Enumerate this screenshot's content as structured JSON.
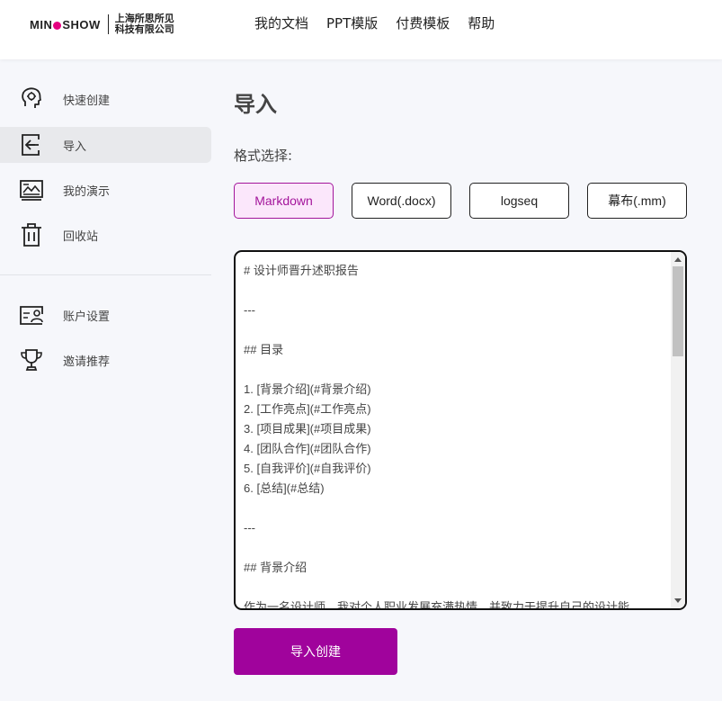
{
  "header": {
    "logo_word_left": "MIN",
    "logo_word_right": "SHOW",
    "logo_company": "上海所思所见\n科技有限公司",
    "nav": [
      {
        "label": "我的文档"
      },
      {
        "label": "PPT模版"
      },
      {
        "label": "付费模板"
      },
      {
        "label": "帮助"
      }
    ]
  },
  "sidebar": {
    "items": [
      {
        "label": "快速创建",
        "icon": "head-idea-icon"
      },
      {
        "label": "导入",
        "icon": "import-icon"
      },
      {
        "label": "我的演示",
        "icon": "presentation-icon"
      },
      {
        "label": "回收站",
        "icon": "trash-icon"
      },
      {
        "label": "账户设置",
        "icon": "account-card-icon"
      },
      {
        "label": "邀请推荐",
        "icon": "trophy-icon"
      }
    ]
  },
  "main": {
    "title": "导入",
    "format_label": "格式选择:",
    "formats": [
      {
        "label": "Markdown",
        "selected": true
      },
      {
        "label": "Word(.docx)",
        "selected": false
      },
      {
        "label": "logseq",
        "selected": false
      },
      {
        "label": "幕布(.mm)",
        "selected": false
      }
    ],
    "editor_text": "# 设计师晋升述职报告\n\n---\n\n## 目录\n\n1. [背景介绍](#背景介绍)\n2. [工作亮点](#工作亮点)\n3. [项目成果](#项目成果)\n4. [团队合作](#团队合作)\n5. [自我评价](#自我评价)\n6. [总结](#总结)\n\n---\n\n## 背景介绍\n\n作为一名设计师，我对个人职业发展充满热情，并致力于提升自己的设计能",
    "submit_label": "导入创建"
  },
  "colors": {
    "accent": "#a0039c",
    "selected_bg": "#fbe7fb",
    "logo_dot": "#e4007f"
  }
}
